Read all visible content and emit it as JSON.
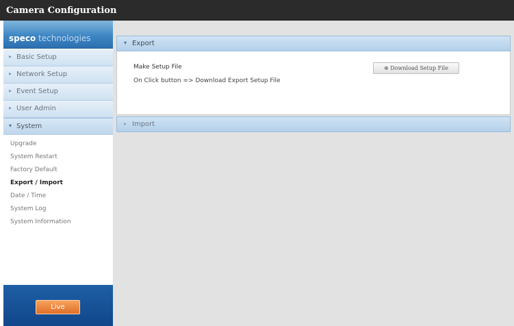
{
  "window": {
    "title": "Camera Configuration"
  },
  "brand": {
    "name_bold": "speco",
    "name_light": " technologies"
  },
  "sidebar": {
    "menu": [
      {
        "label": "Basic Setup",
        "arrow": "▸"
      },
      {
        "label": "Network Setup",
        "arrow": "▸"
      },
      {
        "label": "Event Setup",
        "arrow": "▸"
      },
      {
        "label": "User Admin",
        "arrow": "▸"
      },
      {
        "label": "System",
        "arrow": "▾"
      }
    ],
    "submenu": [
      "Upgrade",
      "System Restart",
      "Factory Default",
      "Export / Import",
      "Date / Time",
      "System Log",
      "System Information"
    ],
    "current_submenu": "Export / Import",
    "live_label": "Live"
  },
  "main": {
    "export": {
      "header": "Export",
      "arrow": "▾",
      "make_label": "Make Setup File",
      "button_label": "⊕ Download Setup File",
      "info": "On Click button => Download Export Setup File"
    },
    "import": {
      "header": "Import",
      "arrow": "▸"
    }
  },
  "colors": {
    "title_bar": "#2b2b2b",
    "menu_bg": "#d9e8f5",
    "panel_header": "#c2dbef",
    "live_button": "#e8833d",
    "sidebar_footer": "#17519a",
    "content_bg": "#e2e2e2"
  }
}
